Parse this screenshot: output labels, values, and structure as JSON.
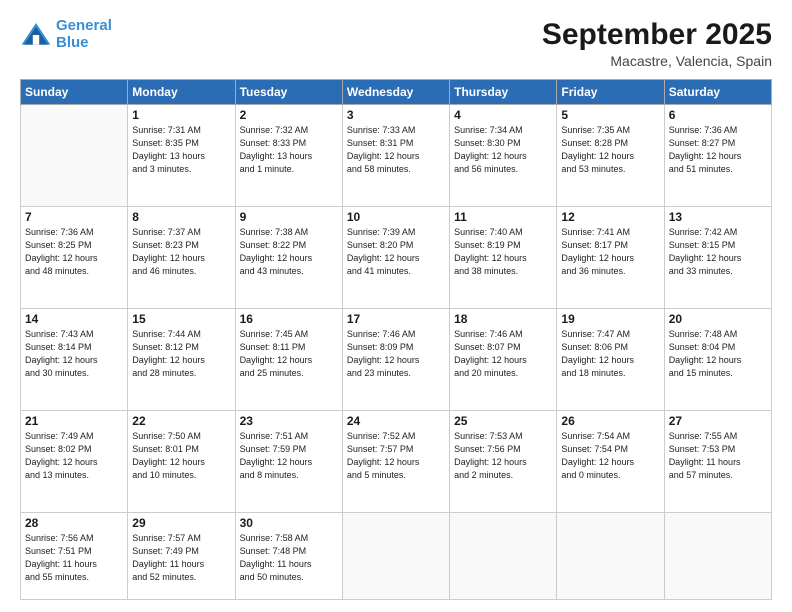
{
  "logo": {
    "line1": "General",
    "line2": "Blue"
  },
  "title": "September 2025",
  "location": "Macastre, Valencia, Spain",
  "days_of_week": [
    "Sunday",
    "Monday",
    "Tuesday",
    "Wednesday",
    "Thursday",
    "Friday",
    "Saturday"
  ],
  "weeks": [
    [
      {
        "day": "",
        "info": ""
      },
      {
        "day": "1",
        "info": "Sunrise: 7:31 AM\nSunset: 8:35 PM\nDaylight: 13 hours\nand 3 minutes."
      },
      {
        "day": "2",
        "info": "Sunrise: 7:32 AM\nSunset: 8:33 PM\nDaylight: 13 hours\nand 1 minute."
      },
      {
        "day": "3",
        "info": "Sunrise: 7:33 AM\nSunset: 8:31 PM\nDaylight: 12 hours\nand 58 minutes."
      },
      {
        "day": "4",
        "info": "Sunrise: 7:34 AM\nSunset: 8:30 PM\nDaylight: 12 hours\nand 56 minutes."
      },
      {
        "day": "5",
        "info": "Sunrise: 7:35 AM\nSunset: 8:28 PM\nDaylight: 12 hours\nand 53 minutes."
      },
      {
        "day": "6",
        "info": "Sunrise: 7:36 AM\nSunset: 8:27 PM\nDaylight: 12 hours\nand 51 minutes."
      }
    ],
    [
      {
        "day": "7",
        "info": "Sunrise: 7:36 AM\nSunset: 8:25 PM\nDaylight: 12 hours\nand 48 minutes."
      },
      {
        "day": "8",
        "info": "Sunrise: 7:37 AM\nSunset: 8:23 PM\nDaylight: 12 hours\nand 46 minutes."
      },
      {
        "day": "9",
        "info": "Sunrise: 7:38 AM\nSunset: 8:22 PM\nDaylight: 12 hours\nand 43 minutes."
      },
      {
        "day": "10",
        "info": "Sunrise: 7:39 AM\nSunset: 8:20 PM\nDaylight: 12 hours\nand 41 minutes."
      },
      {
        "day": "11",
        "info": "Sunrise: 7:40 AM\nSunset: 8:19 PM\nDaylight: 12 hours\nand 38 minutes."
      },
      {
        "day": "12",
        "info": "Sunrise: 7:41 AM\nSunset: 8:17 PM\nDaylight: 12 hours\nand 36 minutes."
      },
      {
        "day": "13",
        "info": "Sunrise: 7:42 AM\nSunset: 8:15 PM\nDaylight: 12 hours\nand 33 minutes."
      }
    ],
    [
      {
        "day": "14",
        "info": "Sunrise: 7:43 AM\nSunset: 8:14 PM\nDaylight: 12 hours\nand 30 minutes."
      },
      {
        "day": "15",
        "info": "Sunrise: 7:44 AM\nSunset: 8:12 PM\nDaylight: 12 hours\nand 28 minutes."
      },
      {
        "day": "16",
        "info": "Sunrise: 7:45 AM\nSunset: 8:11 PM\nDaylight: 12 hours\nand 25 minutes."
      },
      {
        "day": "17",
        "info": "Sunrise: 7:46 AM\nSunset: 8:09 PM\nDaylight: 12 hours\nand 23 minutes."
      },
      {
        "day": "18",
        "info": "Sunrise: 7:46 AM\nSunset: 8:07 PM\nDaylight: 12 hours\nand 20 minutes."
      },
      {
        "day": "19",
        "info": "Sunrise: 7:47 AM\nSunset: 8:06 PM\nDaylight: 12 hours\nand 18 minutes."
      },
      {
        "day": "20",
        "info": "Sunrise: 7:48 AM\nSunset: 8:04 PM\nDaylight: 12 hours\nand 15 minutes."
      }
    ],
    [
      {
        "day": "21",
        "info": "Sunrise: 7:49 AM\nSunset: 8:02 PM\nDaylight: 12 hours\nand 13 minutes."
      },
      {
        "day": "22",
        "info": "Sunrise: 7:50 AM\nSunset: 8:01 PM\nDaylight: 12 hours\nand 10 minutes."
      },
      {
        "day": "23",
        "info": "Sunrise: 7:51 AM\nSunset: 7:59 PM\nDaylight: 12 hours\nand 8 minutes."
      },
      {
        "day": "24",
        "info": "Sunrise: 7:52 AM\nSunset: 7:57 PM\nDaylight: 12 hours\nand 5 minutes."
      },
      {
        "day": "25",
        "info": "Sunrise: 7:53 AM\nSunset: 7:56 PM\nDaylight: 12 hours\nand 2 minutes."
      },
      {
        "day": "26",
        "info": "Sunrise: 7:54 AM\nSunset: 7:54 PM\nDaylight: 12 hours\nand 0 minutes."
      },
      {
        "day": "27",
        "info": "Sunrise: 7:55 AM\nSunset: 7:53 PM\nDaylight: 11 hours\nand 57 minutes."
      }
    ],
    [
      {
        "day": "28",
        "info": "Sunrise: 7:56 AM\nSunset: 7:51 PM\nDaylight: 11 hours\nand 55 minutes."
      },
      {
        "day": "29",
        "info": "Sunrise: 7:57 AM\nSunset: 7:49 PM\nDaylight: 11 hours\nand 52 minutes."
      },
      {
        "day": "30",
        "info": "Sunrise: 7:58 AM\nSunset: 7:48 PM\nDaylight: 11 hours\nand 50 minutes."
      },
      {
        "day": "",
        "info": ""
      },
      {
        "day": "",
        "info": ""
      },
      {
        "day": "",
        "info": ""
      },
      {
        "day": "",
        "info": ""
      }
    ]
  ]
}
